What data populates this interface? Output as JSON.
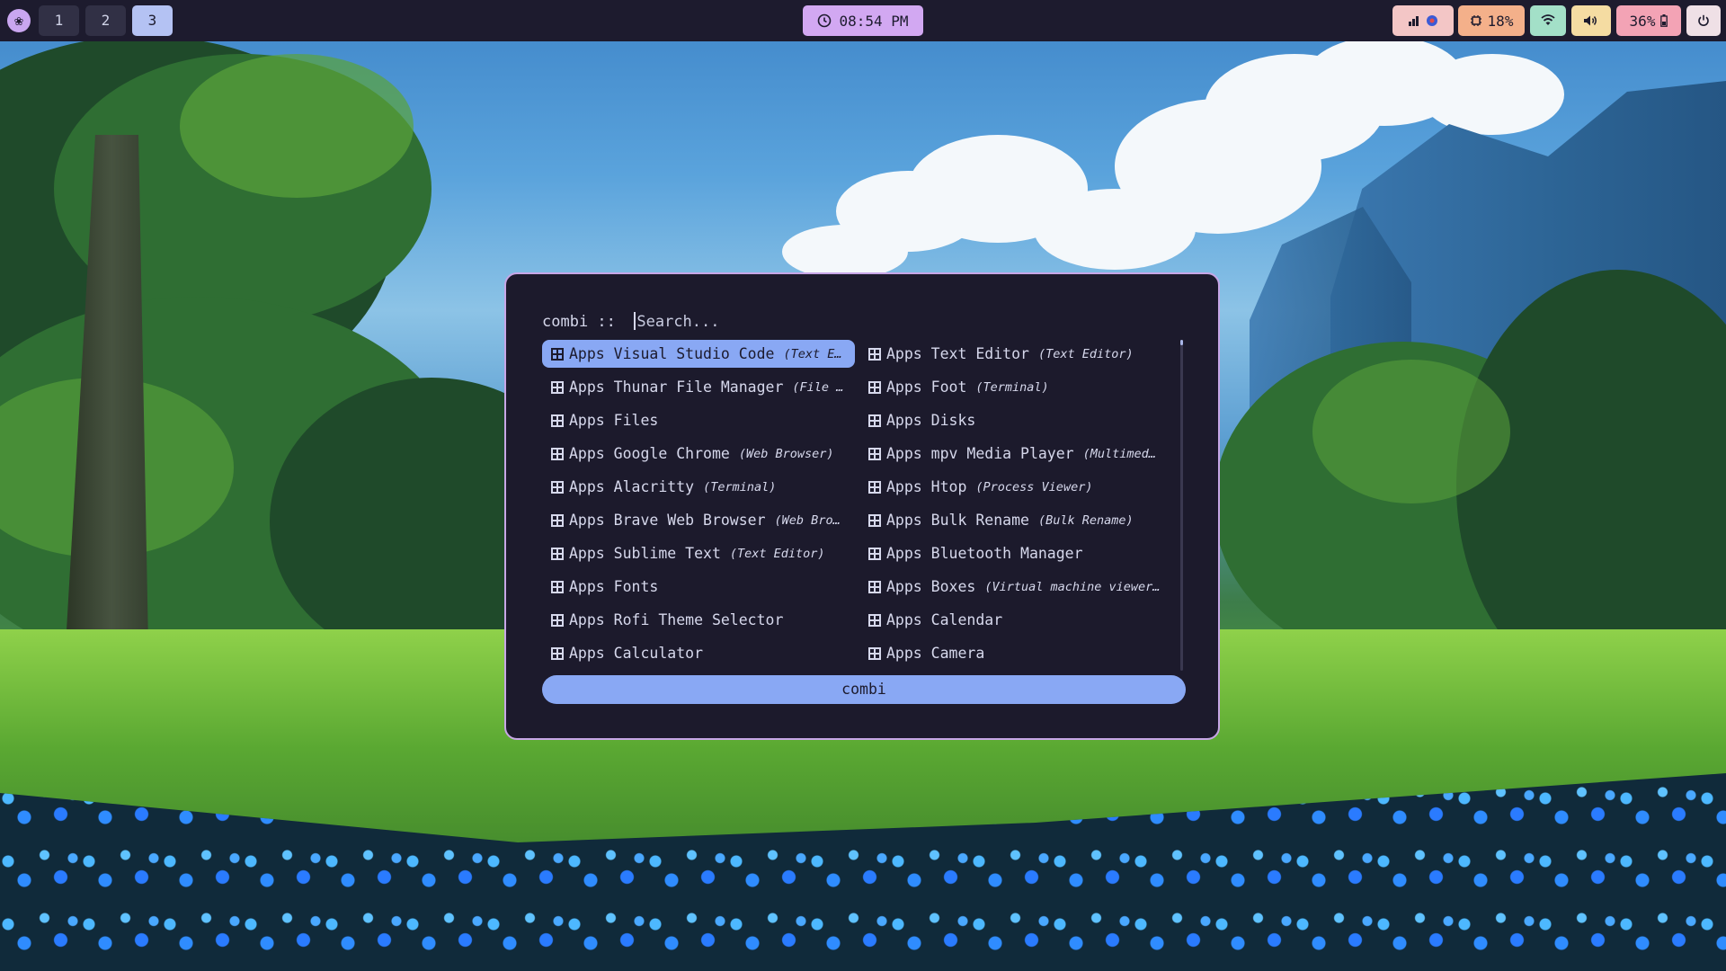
{
  "topbar": {
    "workspaces": [
      "1",
      "2",
      "3"
    ],
    "active_workspace": "3",
    "clock": "08:54 PM",
    "cpu": "18%",
    "battery": "36%"
  },
  "launcher": {
    "mode_prefix": "combi ::",
    "search_placeholder": "Search...",
    "mode_button": "combi",
    "left_column": [
      {
        "name": "Apps Visual Studio Code",
        "desc": "(Text E…"
      },
      {
        "name": "Apps Thunar File Manager",
        "desc": "(File …"
      },
      {
        "name": "Apps Files",
        "desc": ""
      },
      {
        "name": "Apps Google Chrome",
        "desc": "(Web Browser)"
      },
      {
        "name": "Apps Alacritty",
        "desc": "(Terminal)"
      },
      {
        "name": "Apps Brave Web Browser",
        "desc": "(Web Bro…"
      },
      {
        "name": "Apps Sublime Text",
        "desc": "(Text Editor)"
      },
      {
        "name": "Apps Fonts",
        "desc": ""
      },
      {
        "name": "Apps Rofi Theme Selector",
        "desc": ""
      },
      {
        "name": "Apps Calculator",
        "desc": ""
      }
    ],
    "right_column": [
      {
        "name": "Apps Text Editor",
        "desc": "(Text Editor)"
      },
      {
        "name": "Apps Foot",
        "desc": "(Terminal)"
      },
      {
        "name": "Apps Disks",
        "desc": ""
      },
      {
        "name": "Apps mpv Media Player",
        "desc": "(Multimedi…"
      },
      {
        "name": "Apps Htop",
        "desc": "(Process Viewer)"
      },
      {
        "name": "Apps Bulk Rename",
        "desc": "(Bulk Rename)"
      },
      {
        "name": "Apps Bluetooth Manager",
        "desc": ""
      },
      {
        "name": "Apps Boxes",
        "desc": "(Virtual machine viewer…"
      },
      {
        "name": "Apps Calendar",
        "desc": ""
      },
      {
        "name": "Apps Camera",
        "desc": ""
      }
    ],
    "selected_index": 0
  },
  "icons": {
    "logo": "logo-icon",
    "clock": "clock-icon",
    "tray": "tray-icon",
    "cpu": "cpu-icon",
    "wifi": "wifi-icon",
    "volume": "volume-icon",
    "battery": "battery-icon",
    "power": "power-icon",
    "app": "app-grid-icon"
  },
  "colors": {
    "bar_bg": "#1d1b2e",
    "launcher_bg": "#1c1a2c",
    "accent": "#89a8f4",
    "border": "#c7a6e6"
  }
}
